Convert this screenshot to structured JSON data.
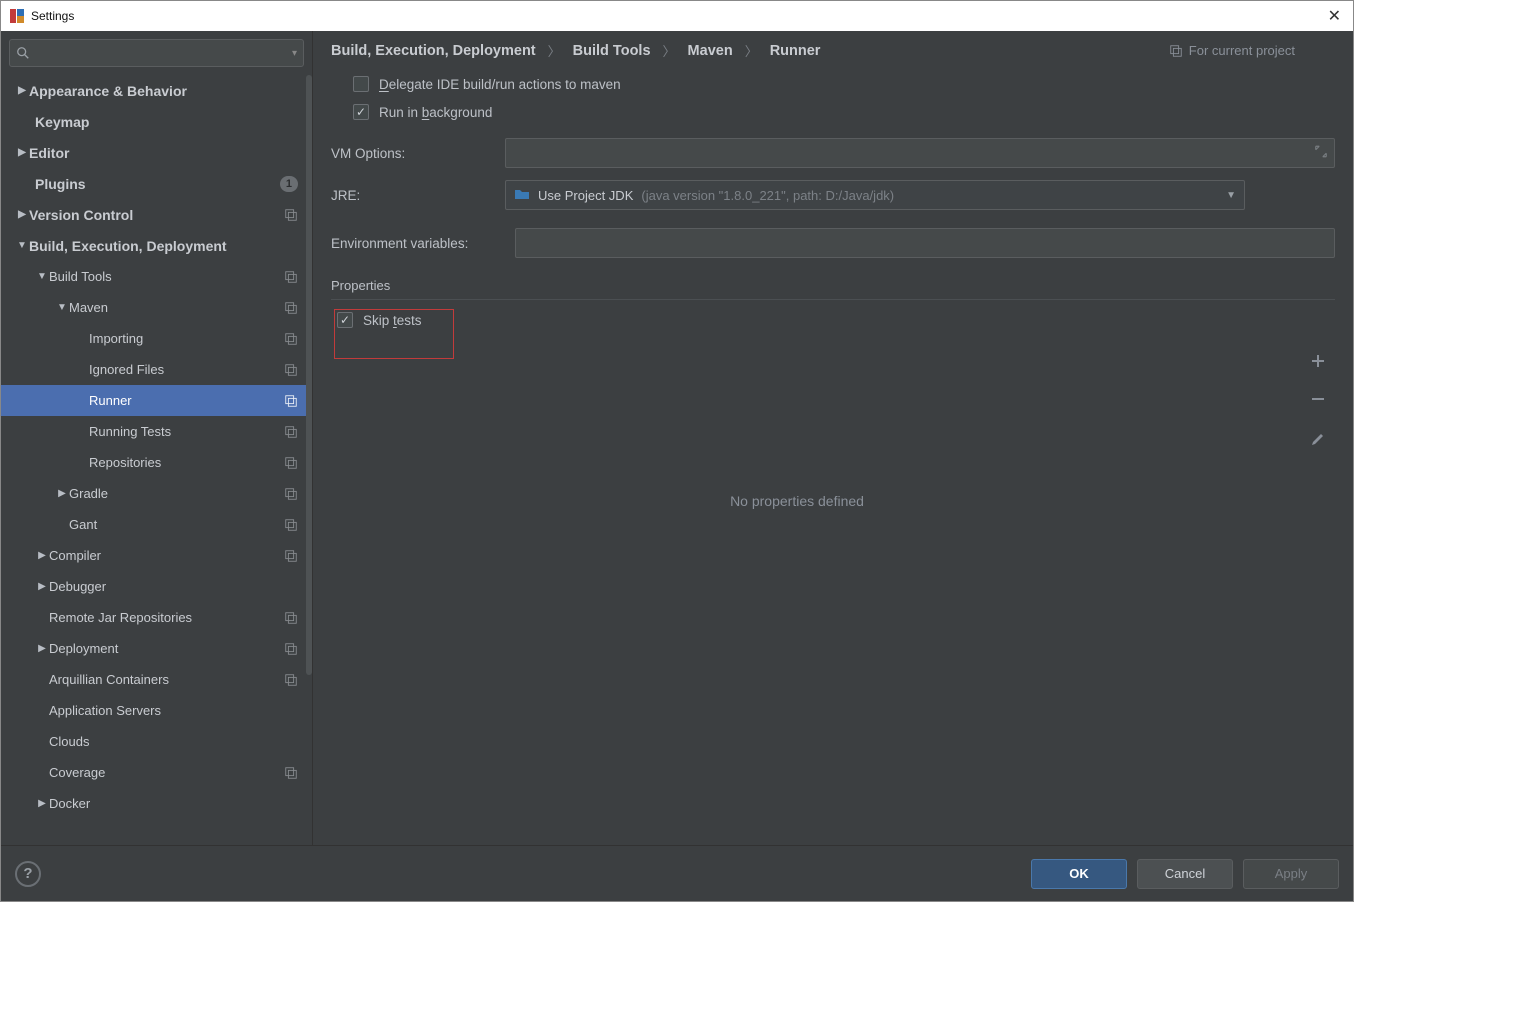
{
  "window": {
    "title": "Settings"
  },
  "search": {
    "placeholder": ""
  },
  "sidebar": {
    "items": [
      {
        "label": "Appearance & Behavior",
        "arrow": "right",
        "top": true
      },
      {
        "label": "Keymap",
        "top": true
      },
      {
        "label": "Editor",
        "arrow": "right",
        "top": true
      },
      {
        "label": "Plugins",
        "top": true,
        "badge": "1"
      },
      {
        "label": "Version Control",
        "arrow": "right",
        "top": true,
        "proj": true
      },
      {
        "label": "Build, Execution, Deployment",
        "arrow": "down",
        "top": true
      },
      {
        "label": "Build Tools",
        "arrow": "down",
        "proj": true,
        "level": 1
      },
      {
        "label": "Maven",
        "arrow": "down",
        "proj": true,
        "level": 2
      },
      {
        "label": "Importing",
        "proj": true,
        "level": 3
      },
      {
        "label": "Ignored Files",
        "proj": true,
        "level": 3
      },
      {
        "label": "Runner",
        "proj": true,
        "level": 3,
        "selected": true
      },
      {
        "label": "Running Tests",
        "proj": true,
        "level": 3
      },
      {
        "label": "Repositories",
        "proj": true,
        "level": 3
      },
      {
        "label": "Gradle",
        "arrow": "right",
        "proj": true,
        "level": 2
      },
      {
        "label": "Gant",
        "proj": true,
        "level": 2
      },
      {
        "label": "Compiler",
        "arrow": "right",
        "proj": true,
        "level": 1
      },
      {
        "label": "Debugger",
        "arrow": "right",
        "level": 1
      },
      {
        "label": "Remote Jar Repositories",
        "proj": true,
        "level": 1
      },
      {
        "label": "Deployment",
        "arrow": "right",
        "proj": true,
        "level": 1
      },
      {
        "label": "Arquillian Containers",
        "proj": true,
        "level": 1
      },
      {
        "label": "Application Servers",
        "level": 1
      },
      {
        "label": "Clouds",
        "level": 1
      },
      {
        "label": "Coverage",
        "proj": true,
        "level": 1
      },
      {
        "label": "Docker",
        "arrow": "right",
        "level": 1
      }
    ]
  },
  "breadcrumbs": {
    "a": "Build, Execution, Deployment",
    "b": "Build Tools",
    "c": "Maven",
    "d": "Runner",
    "project_hint": "For current project"
  },
  "form": {
    "delegate_prefix": "D",
    "delegate_rest": "elegate IDE build/run actions to maven",
    "runbg_prefix": "Run in ",
    "runbg_u": "b",
    "runbg_rest": "ackground",
    "vm_label": "VM Options:",
    "jre_label": "JRE:",
    "jre_text": "Use Project JDK",
    "jre_hint": "(java version \"1.8.0_221\", path: D:/Java/jdk)",
    "env_label": "Environment variables:",
    "props_title": "Properties",
    "skip_prefix": "Skip ",
    "skip_u": "t",
    "skip_rest": "ests",
    "empty_text": "No properties defined"
  },
  "footer": {
    "ok": "OK",
    "cancel": "Cancel",
    "apply": "Apply"
  }
}
